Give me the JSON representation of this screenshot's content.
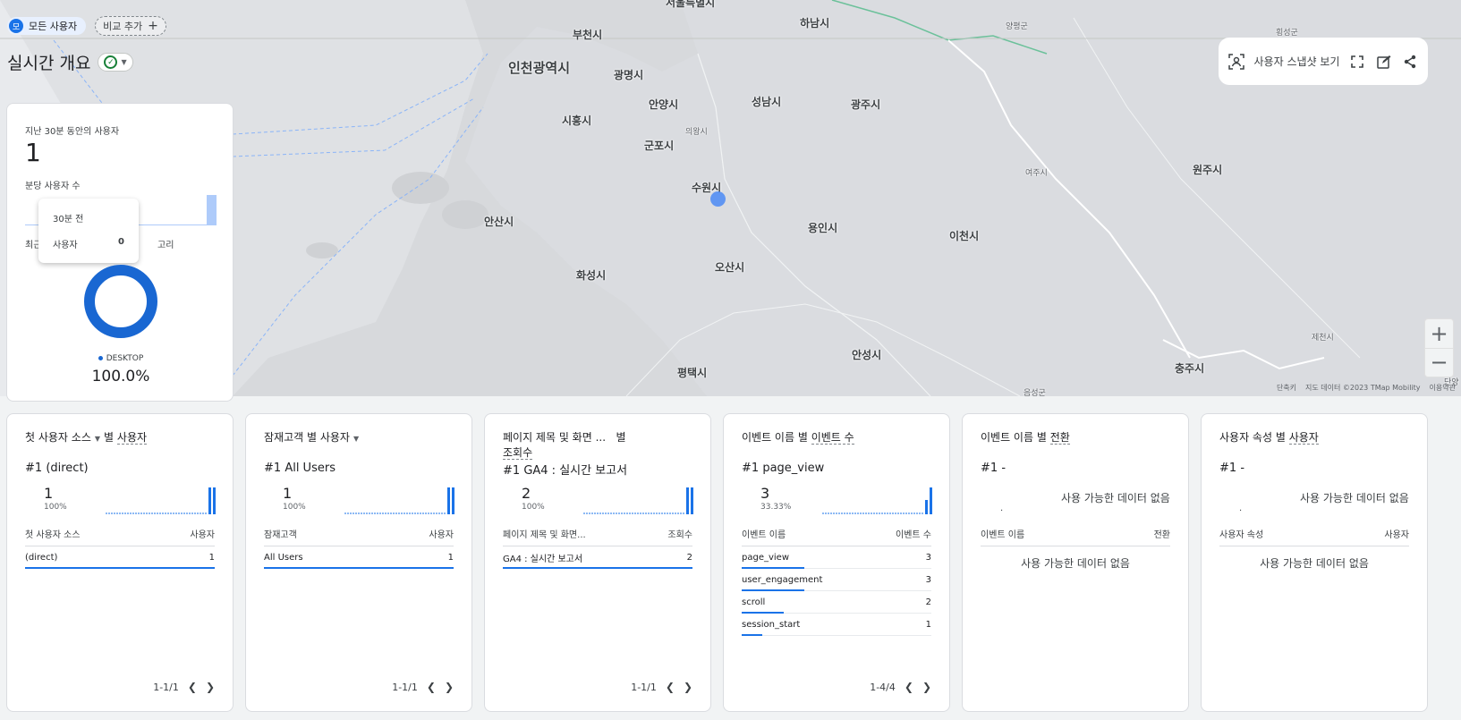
{
  "filter_bar": {
    "segment_avatar": "모",
    "segment_label": "모든 사용자",
    "compare_label": "비교 추가",
    "compare_icon": "plus-icon"
  },
  "page": {
    "title": "실시간 개요"
  },
  "map_toolbar": {
    "snapshot_label": "사용자 스냅샷 보기"
  },
  "map": {
    "cities_big": [
      "인천광역시"
    ],
    "cities": [
      "서울특별시",
      "부천시",
      "하남시",
      "광명시",
      "안양시",
      "성남시",
      "광주시",
      "시흥시",
      "군포시",
      "수원시",
      "안산시",
      "용인시",
      "이천시",
      "오산시",
      "화성시",
      "안성시",
      "평택시",
      "원주시",
      "충주시",
      "제천시"
    ],
    "cities_small": [
      "양평군",
      "횡성군",
      "의왕시",
      "여주시",
      "음성군",
      "단양"
    ],
    "attribution": [
      "단축키",
      "지도 데이터 ©2023 TMap Mobility",
      "이용약관"
    ],
    "zoom_in": "+",
    "zoom_out": "−"
  },
  "summary": {
    "users_30min_label": "지난 30분 동안의 사용자",
    "users_30min_value": "1",
    "per_minute_label": "분당 사용자 수",
    "device_label_left": "최근",
    "device_label_right": "고리",
    "tooltip": {
      "time": "30분 전",
      "metric": "사용자",
      "value": "0"
    },
    "legend_label": "DESKTOP",
    "legend_value": "100.0%",
    "desktop_share": 1.0
  },
  "cards": [
    {
      "title_part1": "첫 사용자 소스",
      "title_mid": "별",
      "title_part2": "사용자",
      "top_rank": "#1",
      "top_name": "(direct)",
      "top_value": "1",
      "top_pct": "100%",
      "col1": "첫 사용자 소스",
      "col2": "사용자",
      "rows": [
        {
          "name": "(direct)",
          "value": "1",
          "share": 1.0
        }
      ],
      "pager": "1-1/1"
    },
    {
      "title_part1": "잠재고객 별 사용자",
      "top_rank": "#1",
      "top_name": "All Users",
      "top_value": "1",
      "top_pct": "100%",
      "col1": "잠재고객",
      "col2": "사용자",
      "rows": [
        {
          "name": "All Users",
          "value": "1",
          "share": 1.0
        }
      ],
      "pager": "1-1/1"
    },
    {
      "title_part1": "페이지 제목 및 화면 ...",
      "title_mid": "별",
      "title_part2": "조회수",
      "top_rank": "#1",
      "top_name": "GA4 : 실시간 보고서",
      "top_value": "2",
      "top_pct": "100%",
      "col1": "페이지 제목 및 화면...",
      "col2": "조회수",
      "rows": [
        {
          "name": "GA4 : 실시간 보고서",
          "value": "2",
          "share": 1.0
        }
      ],
      "pager": "1-1/1"
    },
    {
      "title_part1": "이벤트 이름 별",
      "title_part2": "이벤트 수",
      "top_rank": "#1",
      "top_name": "page_view",
      "top_value": "3",
      "top_pct": "33.33%",
      "col1": "이벤트 이름",
      "col2": "이벤트 수",
      "rows": [
        {
          "name": "page_view",
          "value": "3",
          "share": 0.33
        },
        {
          "name": "user_engagement",
          "value": "3",
          "share": 0.33
        },
        {
          "name": "scroll",
          "value": "2",
          "share": 0.22
        },
        {
          "name": "session_start",
          "value": "1",
          "share": 0.11
        }
      ],
      "pager": "1-4/4"
    },
    {
      "title_part1": "이벤트 이름 별",
      "title_part2": "전환",
      "top_rank": "#1",
      "top_name": "-",
      "no_data_top": "사용 가능한 데이터 없음",
      "no_data_dot": ".",
      "col1": "이벤트 이름",
      "col2": "전환",
      "no_data_body": "사용 가능한 데이터 없음"
    },
    {
      "title_part1": "사용자 속성 별",
      "title_part2": "사용자",
      "top_rank": "#1",
      "top_name": "-",
      "no_data_top": "사용 가능한 데이터 없음",
      "no_data_dot": ".",
      "col1": "사용자 속성",
      "col2": "사용자",
      "no_data_body": "사용 가능한 데이터 없음"
    }
  ],
  "colors": {
    "accent": "#1a73e8",
    "light_accent": "#aecbfa",
    "map_bg": "#dadce0",
    "success": "#188038"
  },
  "icons": {
    "snapshot": "person-frame-icon",
    "fullscreen": "fullscreen-icon",
    "edit": "edit-report-icon",
    "share": "share-icon",
    "status": "check-circle-icon",
    "prev": "chevron-left-icon",
    "next": "chevron-right-icon"
  }
}
